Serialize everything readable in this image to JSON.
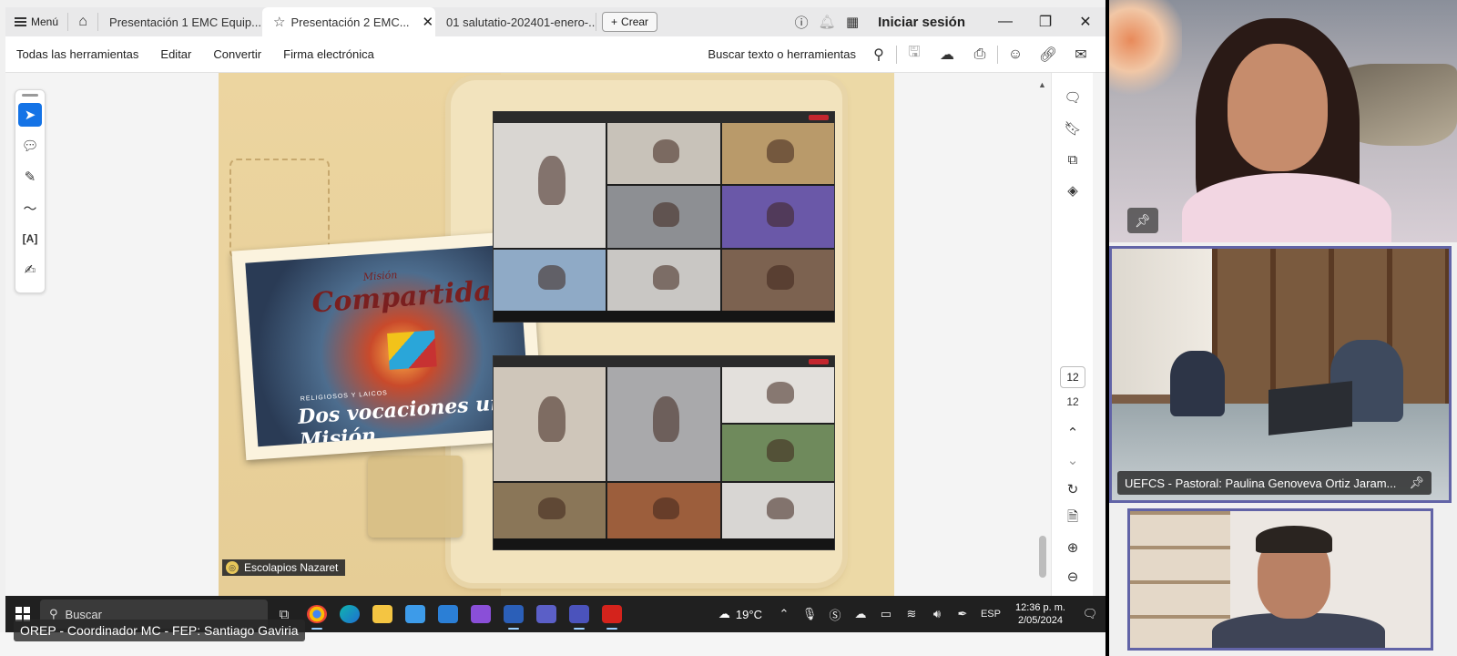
{
  "browser": {
    "menu_label": "Menú",
    "tabs": [
      {
        "label": "Presentación 1 EMC Equip...",
        "active": false
      },
      {
        "label": "Presentación 2 EMC...",
        "active": true
      },
      {
        "label": "01 salutatio-202401-enero-...",
        "active": false
      }
    ],
    "new_label": "Crear",
    "signin_label": "Iniciar sesión"
  },
  "toolbar": {
    "menus": [
      "Todas las herramientas",
      "Editar",
      "Convertir",
      "Firma electrónica"
    ],
    "search_label": "Buscar texto o herramientas"
  },
  "slide": {
    "pretitle": "Misión",
    "title": "Compartida",
    "subtitle_small": "RELIGIOSOS Y LAICOS",
    "subtitle": "Dos vocaciones una Misión",
    "brand": "Escolapios Nazaret",
    "brand_icon": "escolapios-logo-icon"
  },
  "pager": {
    "current": "12",
    "total": "12"
  },
  "taskbar": {
    "search_placeholder": "Buscar",
    "weather": "19°C",
    "lang": "ESP",
    "time": "12:36 p. m.",
    "date": "2/05/2024"
  },
  "meeting": {
    "speaker_name": "OREP - Coordinador MC - FEP: Santiago Gaviria",
    "tile2_name": "UEFCS - Pastoral: Paulina Genoveva Ortiz Jaram..."
  },
  "colors": {
    "accent": "#1473e6",
    "tile_border": "#6264a7",
    "taskbar": "#202020"
  }
}
